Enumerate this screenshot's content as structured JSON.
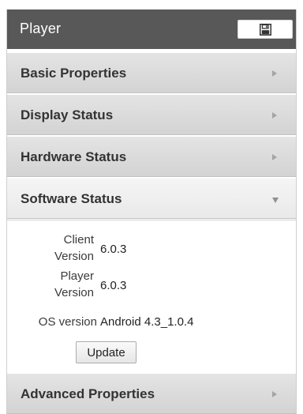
{
  "header": {
    "title": "Player",
    "save_icon": "floppy-disk-icon"
  },
  "sections": {
    "basic": {
      "label": "Basic Properties",
      "state": "collapsed"
    },
    "display": {
      "label": "Display Status",
      "state": "collapsed"
    },
    "hardware": {
      "label": "Hardware Status",
      "state": "collapsed"
    },
    "software": {
      "label": "Software Status",
      "state": "expanded"
    },
    "advanced": {
      "label": "Advanced Properties",
      "state": "collapsed"
    }
  },
  "software": {
    "client_version": {
      "label_line1": "Client",
      "label_line2": "Version",
      "value": "6.0.3"
    },
    "player_version": {
      "label_line1": "Player",
      "label_line2": "Version",
      "value": "6.0.3"
    },
    "os_version": {
      "label": "OS version",
      "value": "Android 4.3_1.0.4"
    },
    "update_label": "Update"
  },
  "colors": {
    "titlebar": "#585858",
    "section_bg": "#d9d9d9",
    "text": "#333333"
  }
}
